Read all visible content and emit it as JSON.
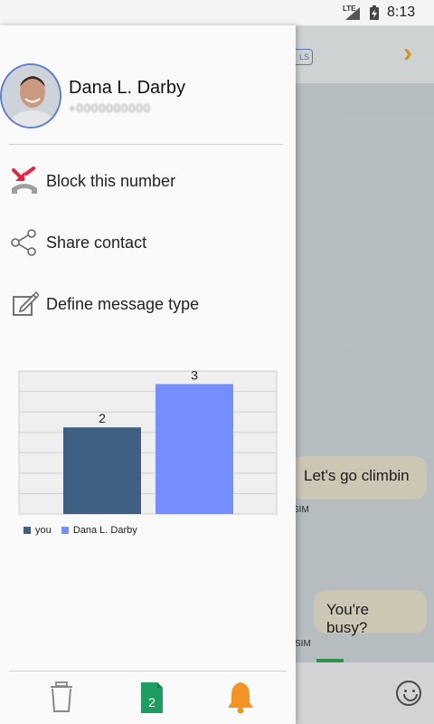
{
  "status_bar": {
    "network": "LTE",
    "time": "8:13"
  },
  "chat": {
    "header_chip": "LS",
    "messages": [
      {
        "text": "Let's go climbin",
        "meta": "SIM"
      },
      {
        "text": "You're busy?",
        "meta": "SIM"
      }
    ],
    "badge": "+"
  },
  "drawer": {
    "contact": {
      "name": "Dana L. Darby",
      "number": "+0000000000"
    },
    "menu": [
      {
        "label": "Block this number",
        "icon": "block-phone-icon"
      },
      {
        "label": "Share contact",
        "icon": "share-icon"
      },
      {
        "label": "Define message type",
        "icon": "edit-message-icon"
      }
    ],
    "bottom_bar": {
      "sim_number": "2",
      "icons": [
        "trash-icon",
        "sim-card-icon",
        "bell-icon"
      ]
    }
  },
  "colors": {
    "you_series": "#3f5f83",
    "contact_series": "#748ffc",
    "accent": "#f5a623",
    "sim_green": "#1e9d63"
  },
  "chart_data": {
    "type": "bar",
    "categories": [
      "you",
      "Dana L. Darby"
    ],
    "series": [
      {
        "name": "you",
        "values": [
          2
        ]
      },
      {
        "name": "Dana L. Darby",
        "values": [
          3
        ]
      }
    ],
    "values": [
      2,
      3
    ],
    "data_labels": [
      "2",
      "3"
    ],
    "ylim": [
      0,
      3.3
    ],
    "grid": true,
    "legend_position": "bottom-left",
    "legend": [
      "you",
      "Dana L. Darby"
    ]
  }
}
